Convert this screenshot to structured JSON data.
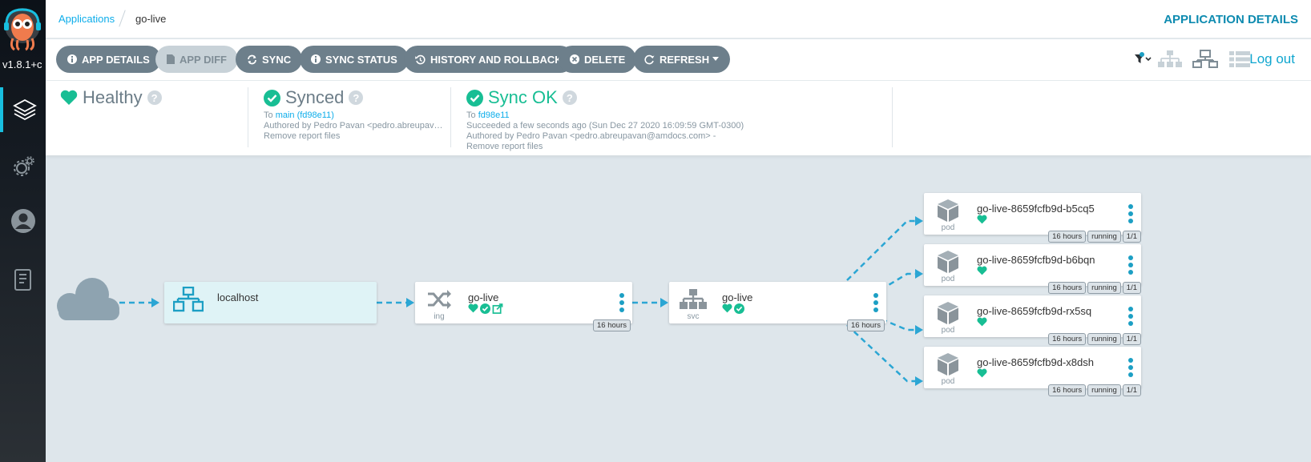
{
  "sidebar": {
    "version": "v1.8.1+c"
  },
  "breadcrumb": {
    "link": "Applications",
    "current": "go-live"
  },
  "page_title": "APPLICATION DETAILS",
  "toolbar": {
    "app_details": "APP DETAILS",
    "app_diff": "APP DIFF",
    "sync": "SYNC",
    "sync_status": "SYNC STATUS",
    "history": "HISTORY AND ROLLBACK",
    "delete": "DELETE",
    "refresh": "REFRESH",
    "logout": "Log out"
  },
  "status": {
    "health": {
      "label": "Healthy"
    },
    "sync": {
      "label": "Synced",
      "to_prefix": "To",
      "to_ref": "main (fd98e11)",
      "author": "Authored by Pedro Pavan <pedro.abreupav…",
      "message": "Remove report files"
    },
    "operation": {
      "label": "Sync OK",
      "to_prefix": "To",
      "to_ref": "fd98e11",
      "result": "Succeeded a few seconds ago (Sun Dec 27 2020 16:09:59 GMT-0300)",
      "author": "Authored by Pedro Pavan <pedro.abreupavan@amdocs.com> -",
      "message": "Remove report files"
    }
  },
  "colors": {
    "accent": "#0dadea",
    "healthy": "#18be94",
    "button": "#6d7f8b",
    "edge": "#2ba6d4"
  },
  "graph": {
    "host": {
      "name": "localhost"
    },
    "ingress": {
      "name": "go-live",
      "kind": "ing",
      "age": "16 hours"
    },
    "service": {
      "name": "go-live",
      "kind": "svc",
      "age": "16 hours"
    },
    "pods": [
      {
        "name": "go-live-8659fcfb9d-b5cq5",
        "kind": "pod",
        "age": "16 hours",
        "status": "running",
        "ready": "1/1"
      },
      {
        "name": "go-live-8659fcfb9d-b6bqn",
        "kind": "pod",
        "age": "16 hours",
        "status": "running",
        "ready": "1/1"
      },
      {
        "name": "go-live-8659fcfb9d-rx5sq",
        "kind": "pod",
        "age": "16 hours",
        "status": "running",
        "ready": "1/1"
      },
      {
        "name": "go-live-8659fcfb9d-x8dsh",
        "kind": "pod",
        "age": "16 hours",
        "status": "running",
        "ready": "1/1"
      }
    ]
  }
}
